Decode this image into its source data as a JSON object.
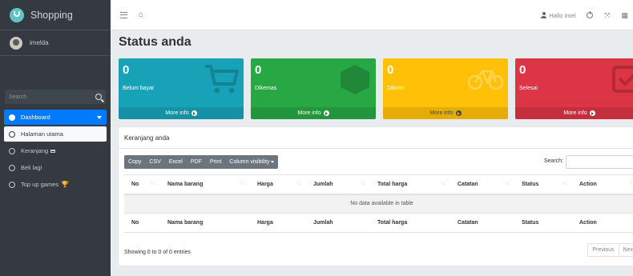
{
  "sidebar": {
    "brand": "Shopping",
    "user_name": "imelda",
    "search_placeholder": "Search",
    "items": [
      {
        "label": "Dashboard"
      },
      {
        "label": "Halaman utama"
      },
      {
        "label": "Keranjang"
      },
      {
        "label": "Beli lagi"
      },
      {
        "label": "Top up games"
      }
    ]
  },
  "topbar": {
    "greeting": "Hallo imel"
  },
  "page": {
    "title": "Status anda"
  },
  "boxes": [
    {
      "count": "0",
      "label": "Belum bayar",
      "footer": "More info",
      "color": "#17a2b8"
    },
    {
      "count": "0",
      "label": "Dikemas",
      "footer": "More info",
      "color": "#28a745"
    },
    {
      "count": "0",
      "label": "Dikirim",
      "footer": "More info",
      "color": "#ffc107"
    },
    {
      "count": "0",
      "label": "Selesai",
      "footer": "More info",
      "color": "#dc3545"
    }
  ],
  "card": {
    "title": "Keranjang anda",
    "buttons": [
      "Copy",
      "CSV",
      "Excel",
      "PDF",
      "Print",
      "Column visibility"
    ],
    "search_label": "Search:",
    "columns": [
      "No",
      "Nama barang",
      "Harga",
      "Jumlah",
      "Total harga",
      "Catatan",
      "Status",
      "Action"
    ],
    "empty_message": "No data available in table",
    "info": "Showing 0 to 0 of 0 entries",
    "pager": {
      "prev": "Previous",
      "next": "Next"
    }
  }
}
